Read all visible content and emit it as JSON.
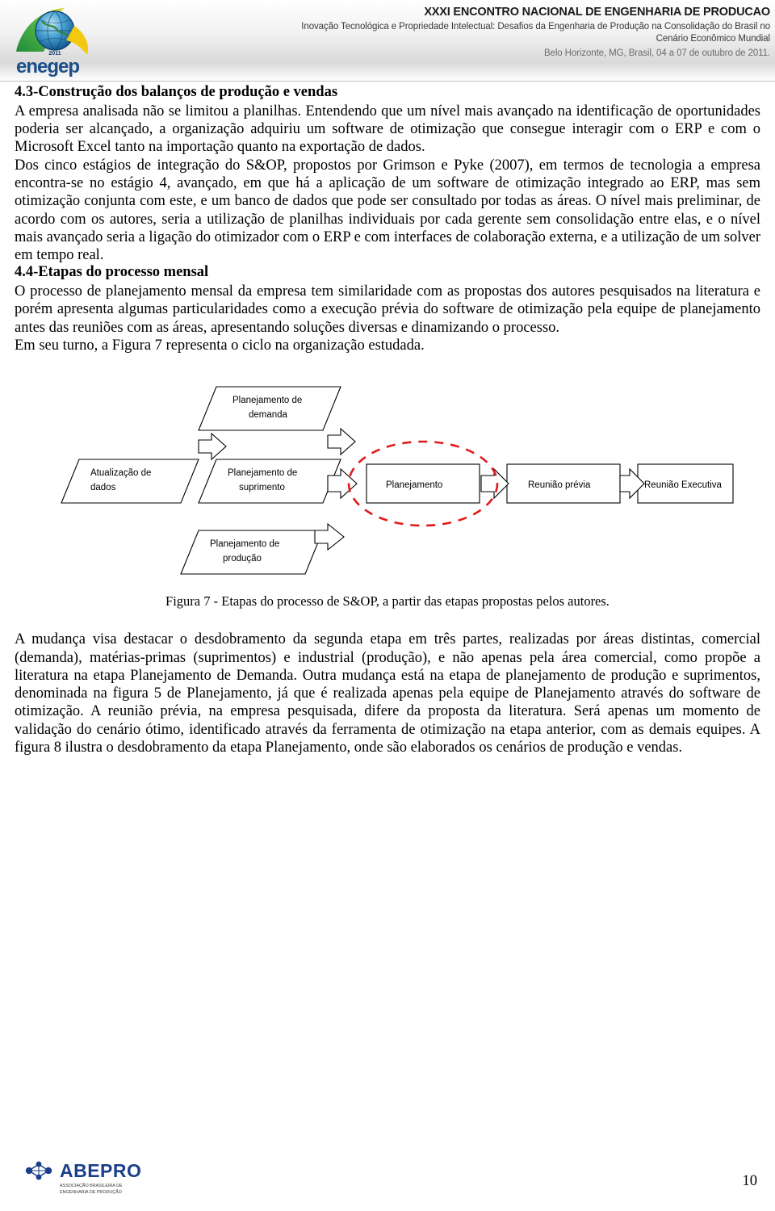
{
  "header": {
    "logo_alt": "ENEGEP 2011 globe logo",
    "logo_year": "2011",
    "logo_word": "enegep",
    "title": "XXXI ENCONTRO NACIONAL DE ENGENHARIA DE PRODUCAO",
    "subtitle_line1": "Inovação Tecnológica e Propriedade Intelectual: Desafios da Engenharia de Produção na Consolidação do Brasil no",
    "subtitle_line2": "Cenário Econômico Mundial",
    "location": "Belo Horizonte, MG, Brasil, 04 a 07 de outubro de 2011."
  },
  "content": {
    "section_43_heading": "4.3-Construção dos balanços de produção e vendas",
    "paragraph_1": "A empresa analisada não se limitou a planilhas. Entendendo que um nível mais avançado na identificação de oportunidades poderia ser alcançado, a organização adquiriu um software de otimização que consegue interagir com o ERP e com o Microsoft Excel tanto na importação quanto na exportação de dados.",
    "paragraph_2": "Dos cinco estágios de integração do S&OP, propostos por Grimson e Pyke (2007), em termos de tecnologia a empresa encontra-se no estágio 4, avançado, em que há a aplicação de um software de otimização integrado ao ERP, mas sem otimização conjunta com este, e um banco de dados que pode ser consultado por todas as áreas. O nível mais preliminar, de acordo com os autores, seria a utilização de planilhas individuais por cada gerente sem consolidação entre elas, e o nível mais avançado seria a ligação do otimizador com o ERP e com interfaces de colaboração externa, e a utilização de um solver em tempo real.",
    "section_44_heading": "4.4-Etapas do processo mensal",
    "paragraph_3": "O processo de planejamento mensal da empresa tem similaridade com as propostas dos autores pesquisados na literatura e porém apresenta algumas particularidades como a execução prévia do software de otimização pela equipe de planejamento antes das reuniões com as áreas, apresentando soluções diversas e dinamizando o processo.",
    "paragraph_4": "Em seu turno, a Figura 7 representa o ciclo na organização estudada.",
    "figure_caption": "Figura 7 - Etapas do processo de S&OP, a partir das etapas propostas pelos autores.",
    "paragraph_5": "A mudança visa destacar o desdobramento da segunda etapa em três partes, realizadas por áreas distintas, comercial (demanda), matérias-primas (suprimentos) e industrial (produção), e não apenas pela área comercial, como propõe a literatura na etapa Planejamento de Demanda. Outra mudança está na etapa de planejamento de produção e suprimentos, denominada na figura 5 de Planejamento, já que é realizada apenas pela equipe de Planejamento através do software de otimização. A reunião prévia, na empresa pesquisada, difere da proposta da literatura. Será apenas um momento de validação do cenário ótimo, identificado através da ferramenta de otimização na etapa anterior, com as demais equipes. A figura 8 ilustra o desdobramento da etapa Planejamento, onde são elaborados os cenários de produção e vendas."
  },
  "figure": {
    "node_atualizacao": "Atualização de dados",
    "node_atualizacao_l1": "Atualização de",
    "node_atualizacao_l2": "dados",
    "node_demanda_l1": "Planejamento de",
    "node_demanda_l2": "demanda",
    "node_suprimento_l1": "Planejamento de",
    "node_suprimento_l2": "suprimento",
    "node_producao_l1": "Planejamento de",
    "node_producao_l2": "produção",
    "node_planejamento": "Planejamento",
    "node_reuniao_previa": "Reunião prévia",
    "node_reuniao_executiva": "Reunião Executiva",
    "highlight_color": "#e01b1b"
  },
  "footer": {
    "abepro_word": "ABEPRO",
    "abepro_sub1": "ASSOCIAÇÃO BRASILEIRA DE",
    "abepro_sub2": "ENGENHARIA DE PRODUÇÃO",
    "page_number": "10"
  }
}
